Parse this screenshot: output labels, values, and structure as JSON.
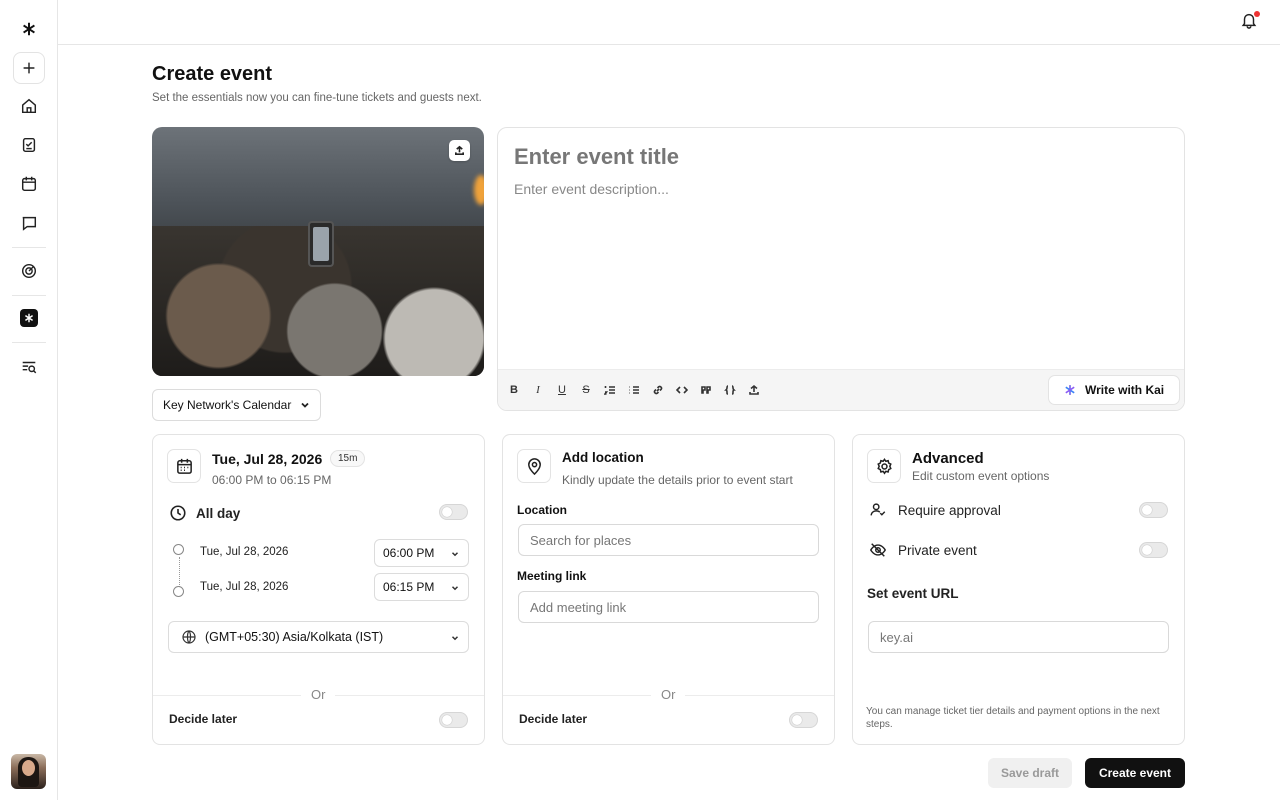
{
  "header": {
    "title": "Create event",
    "subtitle": "Set the essentials now you can fine-tune tickets and guests next."
  },
  "sidebar": {
    "items": [
      {
        "icon": "kai-logo-icon"
      },
      {
        "icon": "plus-icon"
      },
      {
        "icon": "home-icon"
      },
      {
        "icon": "tasks-icon"
      },
      {
        "icon": "calendar-icon"
      },
      {
        "icon": "message-icon"
      },
      {
        "icon": "analytics-icon"
      },
      {
        "icon": "kai-app-icon"
      },
      {
        "icon": "search-list-icon"
      }
    ]
  },
  "calendar_select": {
    "label": "Key Network's Calendar"
  },
  "editor": {
    "title_placeholder": "Enter event title",
    "description_placeholder": "Enter event description...",
    "toolbar": [
      "B",
      "I",
      "U",
      "S"
    ],
    "kai_button": "Write with Kai"
  },
  "schedule": {
    "date": "Tue, Jul 28, 2026",
    "duration": "15m",
    "time_range": "06:00 PM to 06:15 PM",
    "all_day": "All day",
    "start_date": "Tue, Jul 28, 2026",
    "start_time": "06:00 PM",
    "end_date": "Tue, Jul 28, 2026",
    "end_time": "06:15 PM",
    "timezone": "(GMT+05:30) Asia/Kolkata (IST)",
    "or": "Or",
    "decide_later": "Decide later"
  },
  "location": {
    "title": "Add location",
    "subtitle": "Kindly update the details prior to event start",
    "location_label": "Location",
    "location_placeholder": "Search for places",
    "meeting_label": "Meeting link",
    "meeting_placeholder": "Add meeting link",
    "or": "Or",
    "decide_later": "Decide later"
  },
  "advanced": {
    "title": "Advanced",
    "subtitle": "Edit custom event options",
    "require_approval": "Require approval",
    "private_event": "Private event",
    "url_label": "Set event URL",
    "url_placeholder": "key.ai",
    "note": "You can manage ticket tier details and payment options in the next steps."
  },
  "actions": {
    "save_draft": "Save draft",
    "create_event": "Create event"
  }
}
